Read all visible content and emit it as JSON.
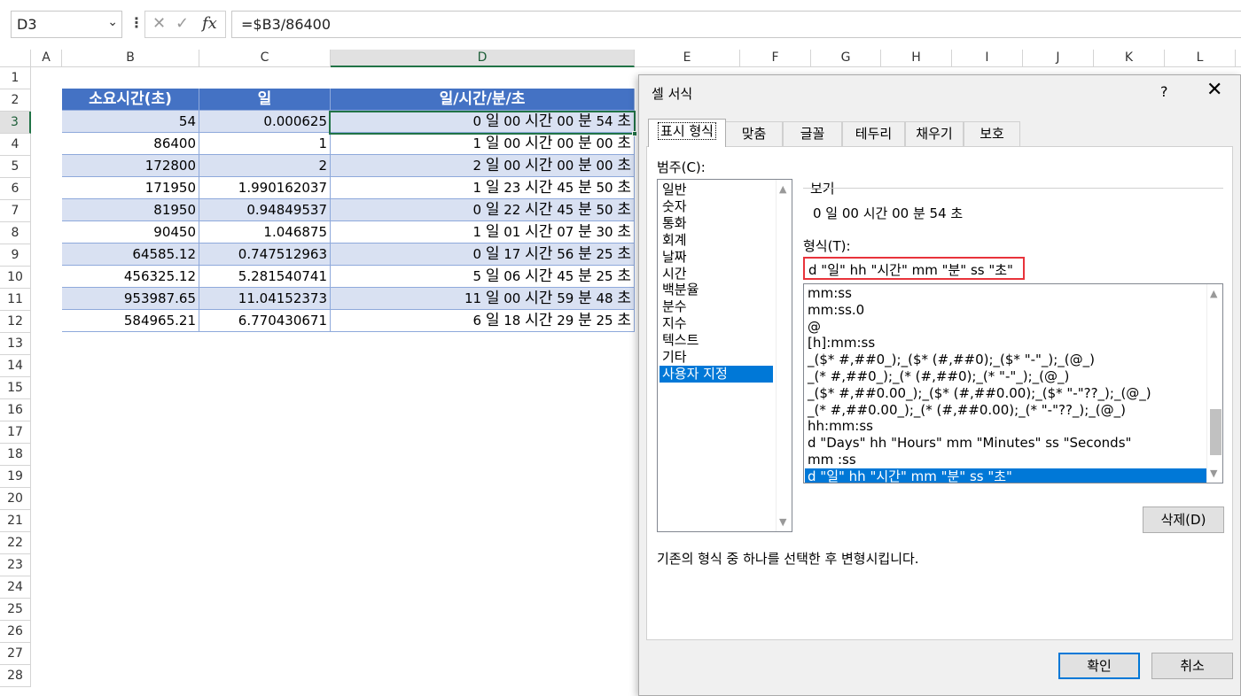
{
  "formula_bar": {
    "name_box": "D3",
    "formula": "=$B3/86400"
  },
  "columns": [
    "A",
    "B",
    "C",
    "D",
    "E",
    "F",
    "G",
    "H",
    "I",
    "J",
    "K",
    "L"
  ],
  "rows": [
    "1",
    "2",
    "3",
    "4",
    "5",
    "6",
    "7",
    "8",
    "9",
    "10",
    "11",
    "12",
    "13",
    "14",
    "15",
    "16",
    "17",
    "18",
    "19",
    "20",
    "21",
    "22",
    "23",
    "24",
    "25",
    "26",
    "27",
    "28"
  ],
  "table": {
    "headers": [
      "소요시간(초)",
      "일",
      "일/시간/분/초"
    ],
    "rows": [
      {
        "b": "54",
        "c": "0.000625",
        "d_num": "0",
        "d_h": "00",
        "d_m": "00",
        "d_s": "54"
      },
      {
        "b": "86400",
        "c": "1",
        "d_num": "1",
        "d_h": "00",
        "d_m": "00",
        "d_s": "00"
      },
      {
        "b": "172800",
        "c": "2",
        "d_num": "2",
        "d_h": "00",
        "d_m": "00",
        "d_s": "00"
      },
      {
        "b": "171950",
        "c": "1.990162037",
        "d_num": "1",
        "d_h": "23",
        "d_m": "45",
        "d_s": "50"
      },
      {
        "b": "81950",
        "c": "0.94849537",
        "d_num": "0",
        "d_h": "22",
        "d_m": "45",
        "d_s": "50"
      },
      {
        "b": "90450",
        "c": "1.046875",
        "d_num": "1",
        "d_h": "01",
        "d_m": "07",
        "d_s": "30"
      },
      {
        "b": "64585.12",
        "c": "0.747512963",
        "d_num": "0",
        "d_h": "17",
        "d_m": "56",
        "d_s": "25"
      },
      {
        "b": "456325.12",
        "c": "5.281540741",
        "d_num": "5",
        "d_h": "06",
        "d_m": "45",
        "d_s": "25"
      },
      {
        "b": "953987.65",
        "c": "11.04152373",
        "d_num": "11",
        "d_h": "00",
        "d_m": "59",
        "d_s": "48"
      },
      {
        "b": "584965.21",
        "c": "6.770430671",
        "d_num": "6",
        "d_h": "18",
        "d_m": "29",
        "d_s": "25"
      }
    ],
    "unit_day": "일",
    "unit_hour": "시간",
    "unit_min": "분",
    "unit_sec": "초"
  },
  "dialog": {
    "title": "셀 서식",
    "help": "?",
    "close": "✕",
    "tabs": [
      "표시 형식",
      "맞춤",
      "글꼴",
      "테두리",
      "채우기",
      "보호"
    ],
    "category_label": "범주(C):",
    "categories": [
      "일반",
      "숫자",
      "통화",
      "회계",
      "날짜",
      "시간",
      "백분율",
      "분수",
      "지수",
      "텍스트",
      "기타",
      "사용자 지정"
    ],
    "selected_category": "사용자 지정",
    "preview_label": "보기",
    "preview_value": "0 일 00 시간 00 분 54 초",
    "format_label": "형식(T):",
    "format_value": "d \"일\" hh \"시간\" mm \"분\" ss \"초\"",
    "formats": [
      "mm:ss",
      "mm:ss.0",
      "@",
      "[h]:mm:ss",
      "_($* #,##0_);_($* (#,##0);_($* \"-\"_);_(@_)",
      "_(* #,##0_);_(* (#,##0);_(* \"-\"_);_(@_)",
      "_($* #,##0.00_);_($* (#,##0.00);_($* \"-\"??_);_(@_)",
      "_(* #,##0.00_);_(* (#,##0.00);_(* \"-\"??_);_(@_)",
      "hh:mm:ss",
      "d \"Days\" hh \"Hours\" mm \"Minutes\" ss \"Seconds\"",
      "mm :ss",
      "d \"일\" hh \"시간\" mm \"분\" ss \"초\""
    ],
    "selected_format": "d \"일\" hh \"시간\" mm \"분\" ss \"초\"",
    "delete_button": "삭제(D)",
    "description": "기존의 형식 중 하나를 선택한 후 변형시킵니다.",
    "ok_button": "확인",
    "cancel_button": "취소"
  },
  "colors": {
    "header_fill": "#4472c4",
    "band_fill": "#d9e1f2",
    "selection_green": "#217346",
    "accent_blue": "#0078d7",
    "highlight_red": "#e8333b"
  }
}
